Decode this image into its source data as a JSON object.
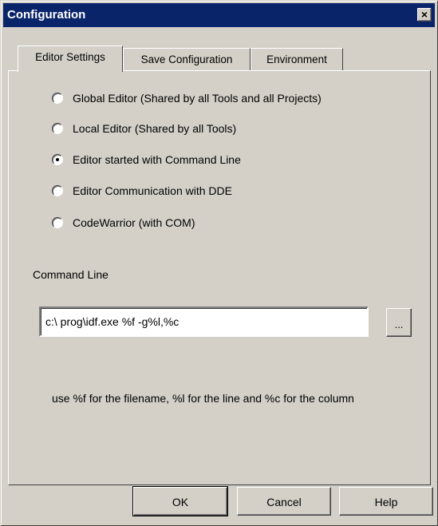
{
  "window": {
    "title": "Configuration",
    "close_glyph": "×"
  },
  "tabs": [
    {
      "label": "Editor Settings",
      "active": true
    },
    {
      "label": "Save Configuration",
      "active": false
    },
    {
      "label": "Environment",
      "active": false
    }
  ],
  "editor_options": [
    {
      "label": "Global Editor (Shared by all Tools and all Projects)",
      "selected": false
    },
    {
      "label": "Local Editor (Shared by all Tools)",
      "selected": false
    },
    {
      "label": "Editor started with Command Line",
      "selected": true
    },
    {
      "label": "Editor Communication with DDE",
      "selected": false
    },
    {
      "label": "CodeWarrior (with COM)",
      "selected": false
    }
  ],
  "command_line": {
    "label": "Command Line",
    "value": "c:\\ prog\\idf.exe %f -g%l,%c",
    "browse_label": "..."
  },
  "hint": "use %f for the filename, %l for the line and %c for the column",
  "buttons": {
    "ok": "OK",
    "cancel": "Cancel",
    "help": "Help"
  }
}
